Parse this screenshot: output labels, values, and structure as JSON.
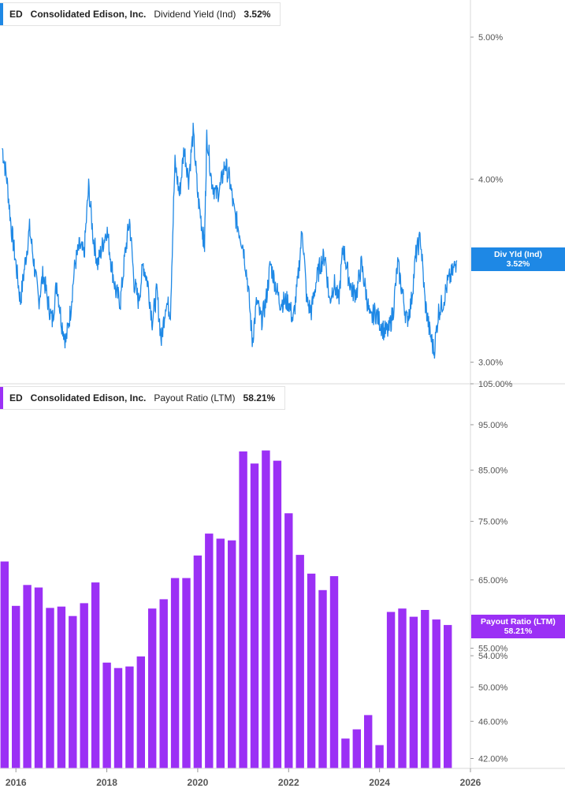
{
  "top_legend": {
    "ticker": "ED",
    "company": "Consolidated Edison, Inc.",
    "metric": "Dividend Yield (Ind)",
    "value": "3.52%"
  },
  "bottom_legend": {
    "ticker": "ED",
    "company": "Consolidated Edison, Inc.",
    "metric": "Payout Ratio (LTM)",
    "value": "58.21%"
  },
  "top_badge": {
    "label": "Div Yld (Ind)",
    "value": "3.52%"
  },
  "bottom_badge": {
    "label": "Payout Ratio (LTM)",
    "value": "58.21%"
  },
  "colors": {
    "yield_line": "#1e88e5",
    "payout_bars": "#9b30f5",
    "axis_text": "#555555",
    "grid": "#d9d9d9"
  },
  "chart_data": [
    {
      "type": "line",
      "series": [
        {
          "name": "Dividend Yield (Ind)",
          "color": "#1e88e5",
          "x": [
            2015.7,
            2015.8,
            2015.9,
            2016.0,
            2016.1,
            2016.2,
            2016.3,
            2016.4,
            2016.5,
            2016.6,
            2016.7,
            2016.8,
            2016.9,
            2017.0,
            2017.1,
            2017.2,
            2017.3,
            2017.4,
            2017.5,
            2017.6,
            2017.7,
            2017.8,
            2017.9,
            2018.0,
            2018.1,
            2018.2,
            2018.3,
            2018.4,
            2018.5,
            2018.6,
            2018.7,
            2018.8,
            2018.9,
            2019.0,
            2019.1,
            2019.2,
            2019.3,
            2019.4,
            2019.5,
            2019.6,
            2019.7,
            2019.8,
            2019.9,
            2020.0,
            2020.1,
            2020.15,
            2020.2,
            2020.3,
            2020.4,
            2020.5,
            2020.6,
            2020.7,
            2020.8,
            2020.9,
            2021.0,
            2021.1,
            2021.2,
            2021.3,
            2021.4,
            2021.5,
            2021.6,
            2021.7,
            2021.8,
            2021.9,
            2022.0,
            2022.1,
            2022.2,
            2022.3,
            2022.4,
            2022.5,
            2022.6,
            2022.7,
            2022.8,
            2022.9,
            2023.0,
            2023.1,
            2023.2,
            2023.3,
            2023.4,
            2023.5,
            2023.6,
            2023.7,
            2023.8,
            2023.9,
            2024.0,
            2024.1,
            2024.2,
            2024.3,
            2024.4,
            2024.5,
            2024.6,
            2024.7,
            2024.8,
            2024.9,
            2025.0,
            2025.1,
            2025.2,
            2025.3,
            2025.4,
            2025.5,
            2025.6,
            2025.7
          ],
          "values": [
            4.2,
            4.0,
            3.7,
            3.5,
            3.3,
            3.5,
            3.7,
            3.5,
            3.3,
            3.45,
            3.3,
            3.2,
            3.4,
            3.2,
            3.1,
            3.25,
            3.5,
            3.6,
            3.55,
            3.95,
            3.65,
            3.5,
            3.6,
            3.7,
            3.5,
            3.35,
            3.3,
            3.55,
            3.75,
            3.4,
            3.3,
            3.5,
            3.4,
            3.2,
            3.35,
            3.1,
            3.3,
            3.25,
            4.1,
            3.9,
            4.2,
            4.0,
            4.3,
            3.9,
            3.7,
            3.6,
            4.3,
            4.0,
            3.9,
            3.95,
            4.1,
            4.0,
            3.8,
            3.7,
            3.6,
            3.4,
            3.1,
            3.3,
            3.2,
            3.3,
            3.5,
            3.4,
            3.3,
            3.3,
            3.3,
            3.2,
            3.4,
            3.7,
            3.3,
            3.25,
            3.4,
            3.5,
            3.55,
            3.3,
            3.4,
            3.3,
            3.6,
            3.45,
            3.35,
            3.35,
            3.5,
            3.35,
            3.2,
            3.25,
            3.2,
            3.15,
            3.15,
            3.25,
            3.5,
            3.35,
            3.2,
            3.3,
            3.55,
            3.65,
            3.3,
            3.15,
            3.05,
            3.25,
            3.3,
            3.4,
            3.45,
            3.52
          ]
        }
      ],
      "ylim": [
        2.9,
        5.3
      ],
      "y_ticks": [
        "5.00%",
        "4.00%",
        "3.00%"
      ],
      "y_tick_values": [
        5.0,
        4.0,
        3.0
      ],
      "log_scale": true
    },
    {
      "type": "bar",
      "series": [
        {
          "name": "Payout Ratio (LTM)",
          "color": "#9b30f5",
          "x": [
            2015.75,
            2016.0,
            2016.25,
            2016.5,
            2016.75,
            2017.0,
            2017.25,
            2017.5,
            2017.75,
            2018.0,
            2018.25,
            2018.5,
            2018.75,
            2019.0,
            2019.25,
            2019.5,
            2019.75,
            2020.0,
            2020.25,
            2020.5,
            2020.75,
            2021.0,
            2021.25,
            2021.5,
            2021.75,
            2022.0,
            2022.25,
            2022.5,
            2022.75,
            2023.0,
            2023.25,
            2023.5,
            2023.75,
            2024.0,
            2024.25,
            2024.5,
            2024.75,
            2025.0,
            2025.25,
            2025.5
          ],
          "values": [
            68.0,
            61.0,
            64.2,
            63.8,
            60.7,
            60.9,
            59.5,
            61.4,
            64.6,
            53.1,
            52.4,
            52.6,
            53.9,
            60.6,
            62.0,
            65.3,
            65.3,
            69.0,
            72.8,
            71.9,
            71.6,
            89.0,
            86.4,
            89.2,
            87.0,
            76.5,
            69.1,
            66.0,
            63.4,
            65.6,
            44.1,
            45.1,
            46.7,
            43.4,
            60.1,
            60.6,
            59.4,
            60.4,
            59.0,
            58.21
          ]
        }
      ],
      "ylim": [
        41,
        105
      ],
      "y_ticks": [
        "105.00%",
        "95.00%",
        "85.00%",
        "75.00%",
        "65.00%",
        "55.00%",
        "54.00%",
        "50.00%",
        "46.00%",
        "42.00%"
      ],
      "y_tick_values": [
        105,
        95,
        85,
        75,
        65,
        55,
        54,
        50,
        46,
        42
      ],
      "log_scale": true
    }
  ],
  "x_axis": {
    "ticks": [
      "2016",
      "2018",
      "2020",
      "2022",
      "2024",
      "2026"
    ],
    "tick_values": [
      2016,
      2018,
      2020,
      2022,
      2024,
      2026
    ],
    "xlim": [
      2015.65,
      2026.0
    ]
  }
}
